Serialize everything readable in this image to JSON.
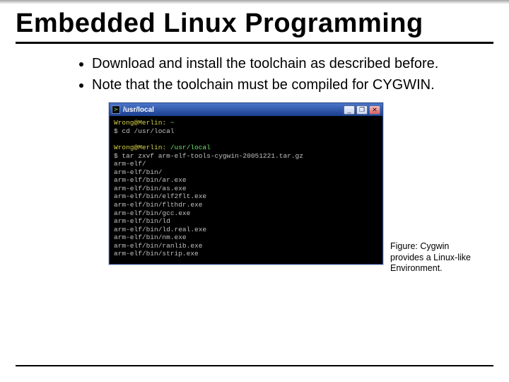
{
  "title": "Embedded Linux Programming",
  "bullets": [
    "Download and install the toolchain as described before.",
    "Note that the toolchain must be compiled for CYGWIN."
  ],
  "caption": "Figure: Cygwin provides a Linux-like Environment.",
  "terminal": {
    "window_title": "/usr/local",
    "btn_min": "_",
    "btn_max": "❐",
    "btn_close": "✕",
    "prompt1_userhost": "Wrong@Merlin:",
    "prompt1_path": " ~",
    "line_cd": "$ cd /usr/local",
    "prompt2_userhost": "Wrong@Merlin:",
    "prompt2_path": " /usr/local",
    "line_tar": "$ tar zxvf arm-elf-tools-cygwin-20051221.tar.gz",
    "out0": "arm-elf/",
    "out1": "arm-elf/bin/",
    "out2": "arm-elf/bin/ar.exe",
    "out3": "arm-elf/bin/as.exe",
    "out4": "arm-elf/bin/elf2flt.exe",
    "out5": "arm-elf/bin/flthdr.exe",
    "out6": "arm-elf/bin/gcc.exe",
    "out7": "arm-elf/bin/ld",
    "out8": "arm-elf/bin/ld.real.exe",
    "out9": "arm-elf/bin/nm.exe",
    "out10": "arm-elf/bin/ranlib.exe",
    "out11": "arm-elf/bin/strip.exe"
  }
}
